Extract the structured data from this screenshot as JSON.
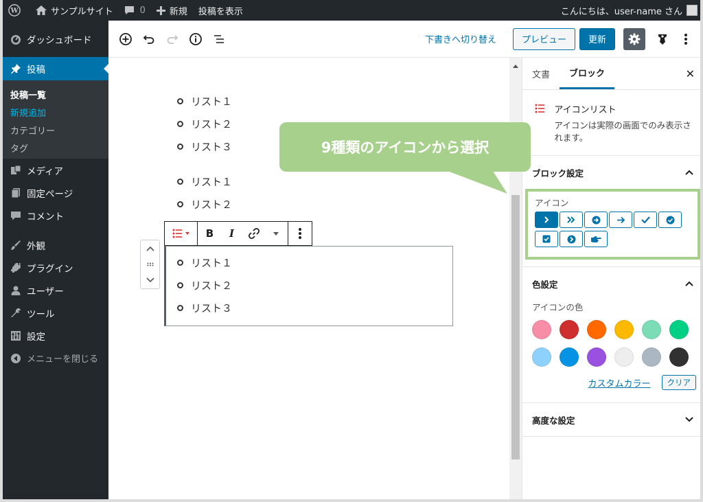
{
  "adminbar": {
    "site_name": "サンプルサイト",
    "comments_count": "0",
    "new_label": "新規",
    "view_post": "投稿を表示",
    "greeting": "こんにちは、user-name さん"
  },
  "sidebar": {
    "dashboard": "ダッシュボード",
    "posts": "投稿",
    "submenu": [
      "投稿一覧",
      "新規追加",
      "カテゴリー",
      "タグ"
    ],
    "media": "メディア",
    "pages": "固定ページ",
    "comments": "コメント",
    "appearance": "外観",
    "plugins": "プラグイン",
    "users": "ユーザー",
    "tools": "ツール",
    "settings": "設定",
    "collapse": "メニューを閉じる"
  },
  "header": {
    "switch_to_draft": "下書きへ切り替え",
    "preview": "プレビュー",
    "update": "更新"
  },
  "content": {
    "list1": [
      "リスト１",
      "リスト２",
      "リスト３"
    ],
    "list2": [
      "リスト１",
      "リスト２"
    ],
    "list3": [
      "リスト１",
      "リスト２",
      "リスト３"
    ]
  },
  "block_toolbar": {
    "bold": "B",
    "italic": "I"
  },
  "settings": {
    "tab_document": "文書",
    "tab_block": "ブロック",
    "block_name": "アイコンリスト",
    "block_desc": "アイコンは実際の画面でのみ表示されます。",
    "block_settings": "ブロック設定",
    "icon_label": "アイコン",
    "color_settings": "色設定",
    "icon_color_label": "アイコンの色",
    "custom_color": "カスタムカラー",
    "clear": "クリア",
    "advanced": "高度な設定",
    "swatches": [
      "#f78da7",
      "#cf2e2e",
      "#ff6900",
      "#fcb900",
      "#7bdcb5",
      "#00d084",
      "#8ed1fc",
      "#0693e3",
      "#9b51e0",
      "#eeeeee",
      "#abb8c3",
      "#313131"
    ]
  },
  "callout": {
    "text": "9種類のアイコンから選択"
  },
  "colors": {
    "accent": "#0073aa",
    "callout": "#a8d08d",
    "sidebar_bg": "#23282d"
  }
}
